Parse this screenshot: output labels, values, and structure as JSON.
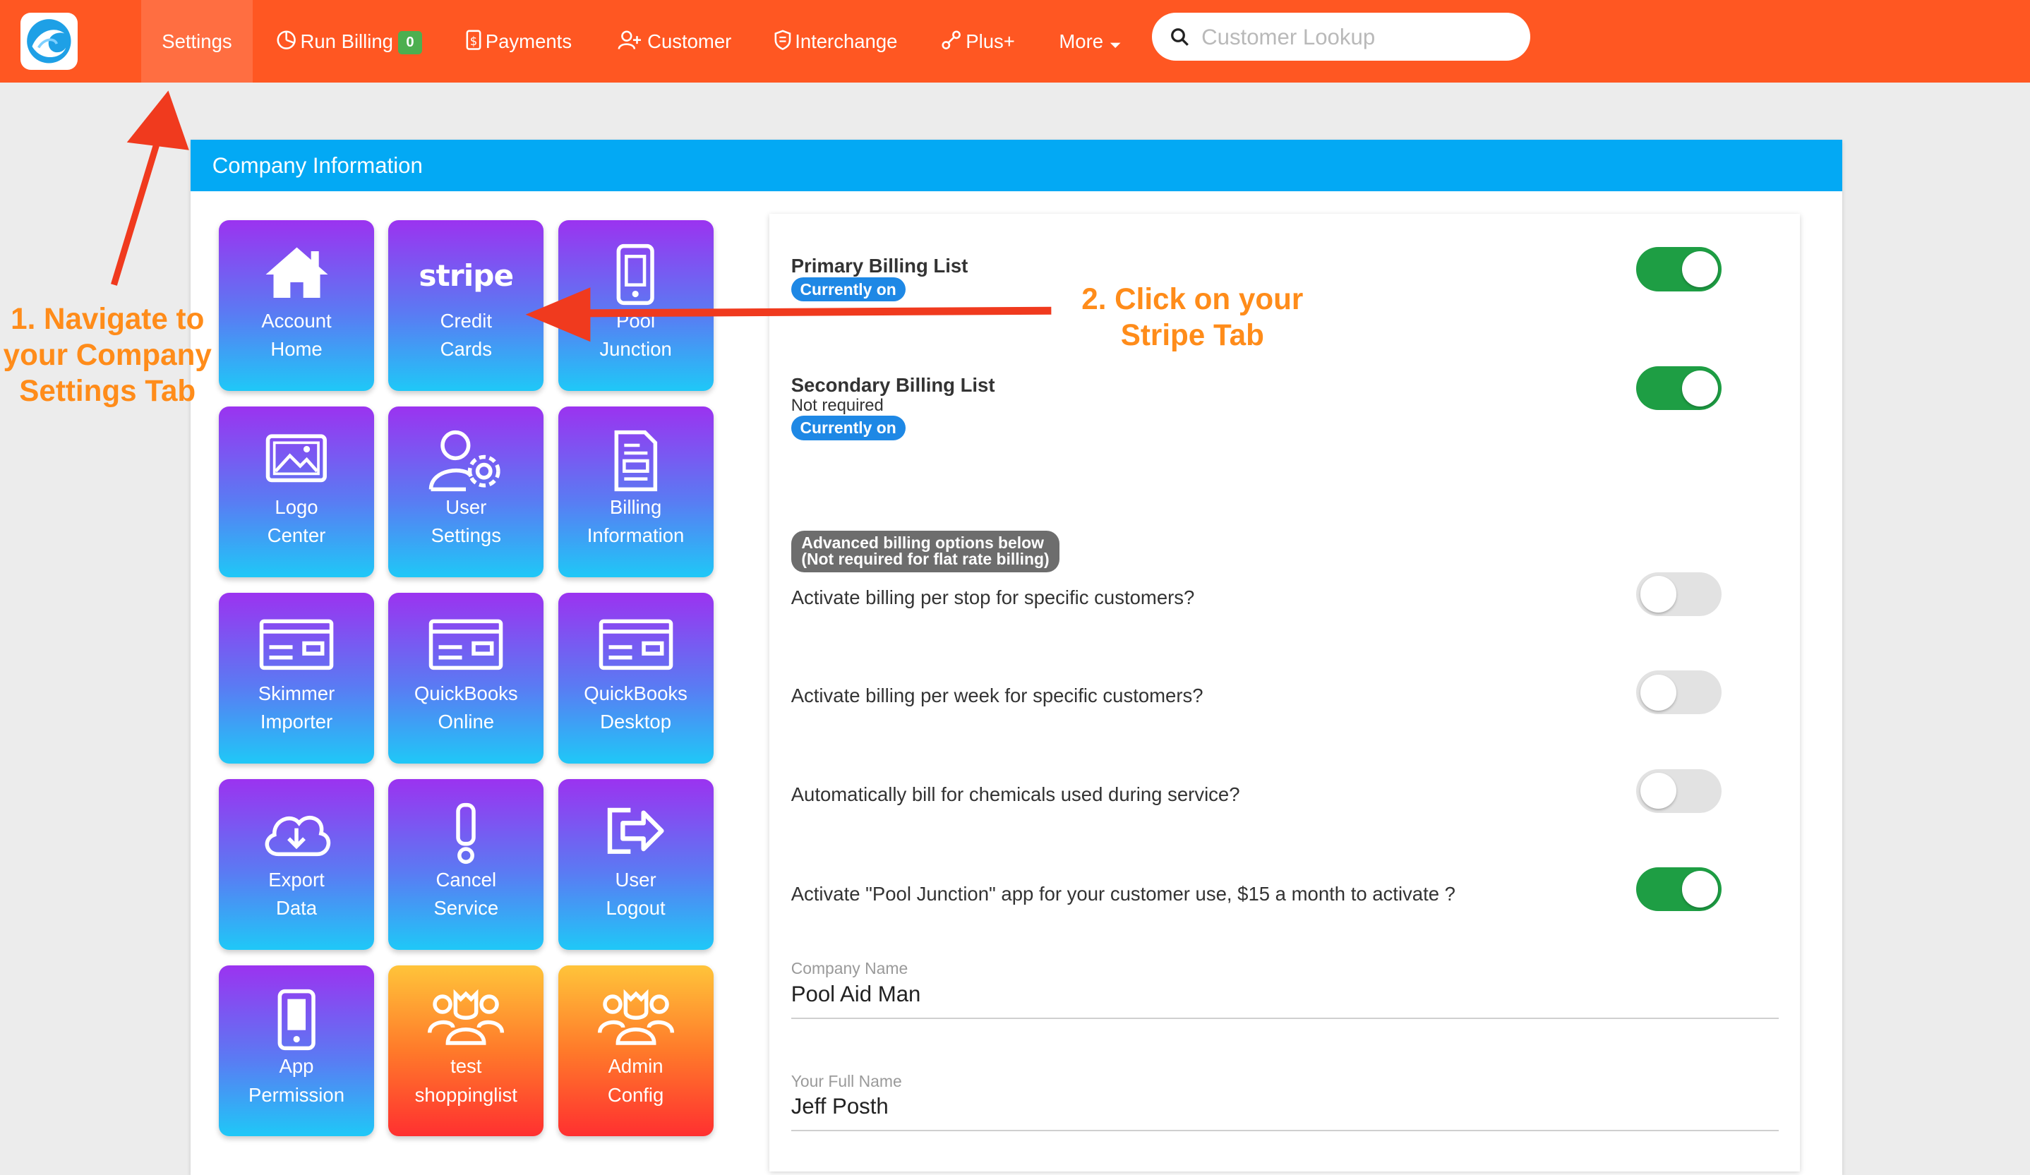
{
  "nav": {
    "settings": "Settings",
    "run_billing": "Run Billing",
    "run_billing_count": "0",
    "payments": "Payments",
    "customer": "Customer",
    "interchange": "Interchange",
    "plus": "Plus+",
    "more": "More",
    "search_placeholder": "Customer Lookup"
  },
  "card": {
    "title": "Company Information"
  },
  "tiles": [
    {
      "l1": "Account",
      "l2": "Home",
      "icon": "home-icon"
    },
    {
      "l1": "Credit",
      "l2": "Cards",
      "icon": "stripe-icon",
      "word": "stripe"
    },
    {
      "l1": "Pool",
      "l2": "Junction",
      "icon": "phone-icon"
    },
    {
      "l1": "Logo",
      "l2": "Center",
      "icon": "image-icon"
    },
    {
      "l1": "User",
      "l2": "Settings",
      "icon": "user-gear-icon"
    },
    {
      "l1": "Billing",
      "l2": "Information",
      "icon": "document-icon"
    },
    {
      "l1": "Skimmer",
      "l2": "Importer",
      "icon": "card-icon"
    },
    {
      "l1": "QuickBooks",
      "l2": "Online",
      "icon": "card-icon"
    },
    {
      "l1": "QuickBooks",
      "l2": "Desktop",
      "icon": "card-icon"
    },
    {
      "l1": "Export",
      "l2": "Data",
      "icon": "cloud-download-icon"
    },
    {
      "l1": "Cancel",
      "l2": "Service",
      "icon": "exclamation-icon"
    },
    {
      "l1": "User",
      "l2": "Logout",
      "icon": "logout-icon"
    },
    {
      "l1": "App",
      "l2": "Permission",
      "icon": "phone-icon"
    },
    {
      "l1": "test",
      "l2": "shoppinglist",
      "icon": "group-icon"
    },
    {
      "l1": "Admin",
      "l2": "Config",
      "icon": "group-icon"
    }
  ],
  "billing": {
    "primary_label": "Primary Billing List",
    "primary_status": "Currently on",
    "primary_on": true,
    "secondary_label": "Secondary Billing List",
    "secondary_note": "Not required",
    "secondary_status": "Currently on",
    "secondary_on": true,
    "advanced_line1": "Advanced billing options below",
    "advanced_line2": "(Not required for flat rate billing)",
    "per_stop": "Activate billing per stop for specific customers?",
    "per_stop_on": false,
    "per_week": "Activate billing per week for specific customers?",
    "per_week_on": false,
    "chemicals": "Automatically bill for chemicals used during service?",
    "chemicals_on": false,
    "pool_junction": "Activate \"Pool Junction\" app for your customer use, $15 a month to activate ?",
    "pool_junction_on": true
  },
  "fields": {
    "company_name_label": "Company Name",
    "company_name": "Pool Aid Man",
    "full_name_label": "Your Full Name",
    "full_name": "Jeff Posth"
  },
  "annotations": {
    "step1_l1": "1. Navigate to",
    "step1_l2": "your Company",
    "step1_l3": "Settings Tab",
    "step2_l1": "2. Click on your",
    "step2_l2": "Stripe Tab"
  },
  "colors": {
    "nav_bg": "#ff5722",
    "header_bg": "#03a9f4",
    "toggle_on": "#1e9e44",
    "pill_blue": "#1e88e5",
    "annotation": "#ff8c1a",
    "arrow": "#f03a1e"
  }
}
